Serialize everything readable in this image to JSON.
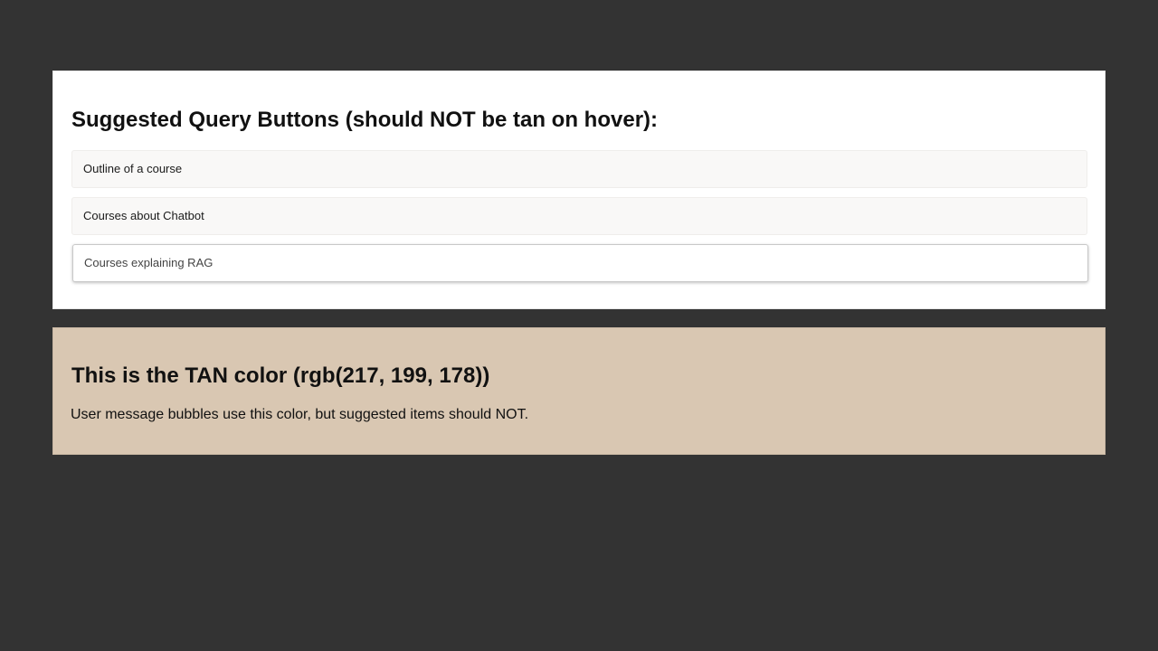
{
  "suggested": {
    "heading": "Suggested Query Buttons (should NOT be tan on hover):",
    "items": [
      {
        "label": "Outline of a course"
      },
      {
        "label": "Courses about Chatbot"
      },
      {
        "label": "Courses explaining RAG"
      }
    ]
  },
  "tan_box": {
    "heading": "This is the TAN color (rgb(217, 199, 178))",
    "description": "User message bubbles use this color, but suggested items should NOT.",
    "color": "#d9c7b2"
  },
  "colors": {
    "background": "#333333",
    "panel": "#ffffff",
    "suggest_item": "#f9f8f7"
  }
}
